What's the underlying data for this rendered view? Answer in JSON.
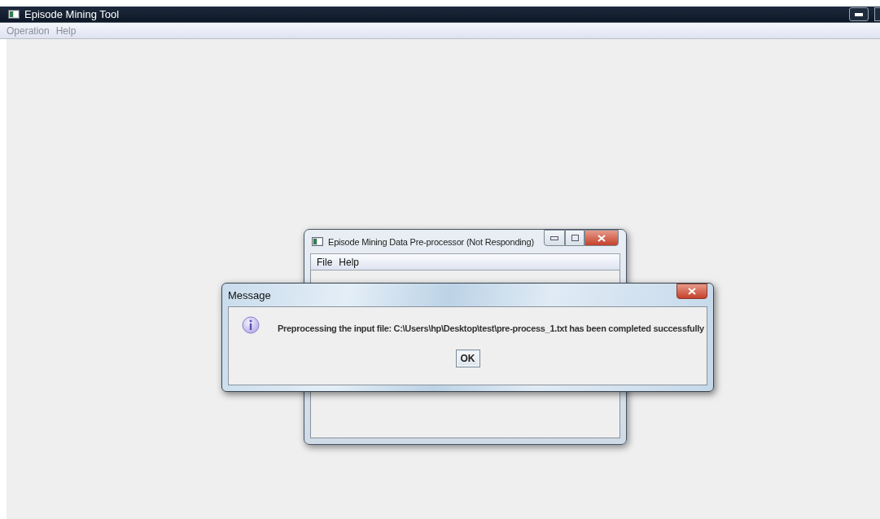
{
  "window": {
    "title": "Episode Mining Tool"
  },
  "menu": [
    "Operation",
    "Help"
  ],
  "preprocessor_window": {
    "title": "Episode Mining Data Pre-processor (Not Responding)",
    "menu": [
      "File",
      "Help"
    ]
  },
  "message_dialog": {
    "title": "Message",
    "message": "Preprocessing the input file: C:\\Users\\hp\\Desktop\\test\\pre-process_1.txt has been completed successfully",
    "buttons": [
      "OK"
    ]
  }
}
